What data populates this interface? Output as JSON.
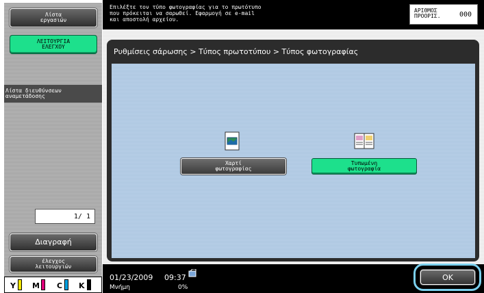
{
  "sidebar": {
    "job_list_label": "Λίστα\nεργασιών",
    "function_check_label": "ΛΕΙΤΟΥΡΓΙΑ\nΕΛΕΓΧΟΥ",
    "address_list_label": "Λίστα διευθύνσεων\nαναμετάδοσης",
    "page_counter": "1/  1",
    "delete_label": "Διαγραφή",
    "check_function_label": "έλεγχος\nλειτουργιών",
    "toner": [
      "Y",
      "M",
      "C",
      "K"
    ],
    "toner_colors": [
      "#f2e600",
      "#e0007a",
      "#00a0e0",
      "#000000"
    ]
  },
  "header": {
    "message": "Επιλέξτε τον τύπο φωτογραφίας για το πρωτότυπο\nπου πρόκειται να σαρωθεί. Εφαρμογή σε e-mail\nκαι αποστολή αρχείου.",
    "originals_label": "ΑΡΙΘΜΟΣ\nΠΡΟΟΡΙΣ.",
    "originals_count": "000"
  },
  "main": {
    "breadcrumb": "Ρυθμίσεις σάρωσης > Τύπος πρωτοτύπου > Τύπος φωτογραφίας",
    "options": [
      {
        "label": "Χαρτί\nφωτογραφίας",
        "icon": "photo-paper-icon",
        "selected": false
      },
      {
        "label": "Τυπωμένη\nφωτογραφία",
        "icon": "printed-photo-icon",
        "selected": true
      }
    ]
  },
  "status": {
    "date": "01/23/2009",
    "time": "09:37",
    "memory_label": "Μνήμη",
    "memory_value": "0%",
    "ok_label": "OK"
  }
}
